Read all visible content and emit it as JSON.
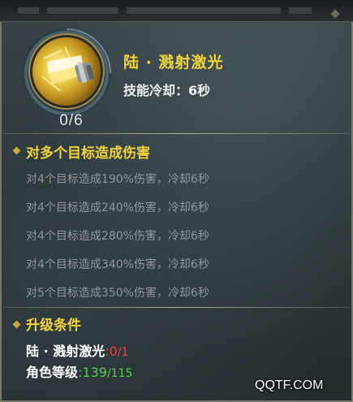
{
  "skill": {
    "name": "陆 · 溅射激光",
    "cooldown": "技能冷却：6秒",
    "level_count": "0/6",
    "icon": "laser-skill-icon"
  },
  "effect_section": {
    "title": "对多个目标造成伤害",
    "levels": [
      "对4个目标造成190%伤害，冷却6秒",
      "对4个目标造成240%伤害，冷却6秒",
      "对4个目标造成280%伤害，冷却6秒",
      "对4个目标造成340%伤害，冷却6秒",
      "对5个目标造成350%伤害，冷却6秒"
    ]
  },
  "upgrade_section": {
    "title": "升级条件",
    "requirements": [
      {
        "label": "陆 · 溅射激光",
        "sep": ":",
        "current": "0",
        "max": "/1"
      },
      {
        "label": "角色等级",
        "sep": ":",
        "current": "139",
        "max": "/115"
      }
    ]
  },
  "watermark": "QQTF.COM",
  "colors": {
    "title_yellow": "#f2d33a",
    "level_gray": "#8f989b",
    "unmet_red": "#e04848",
    "met_green": "#4fd04a",
    "border": "#7b7866"
  }
}
